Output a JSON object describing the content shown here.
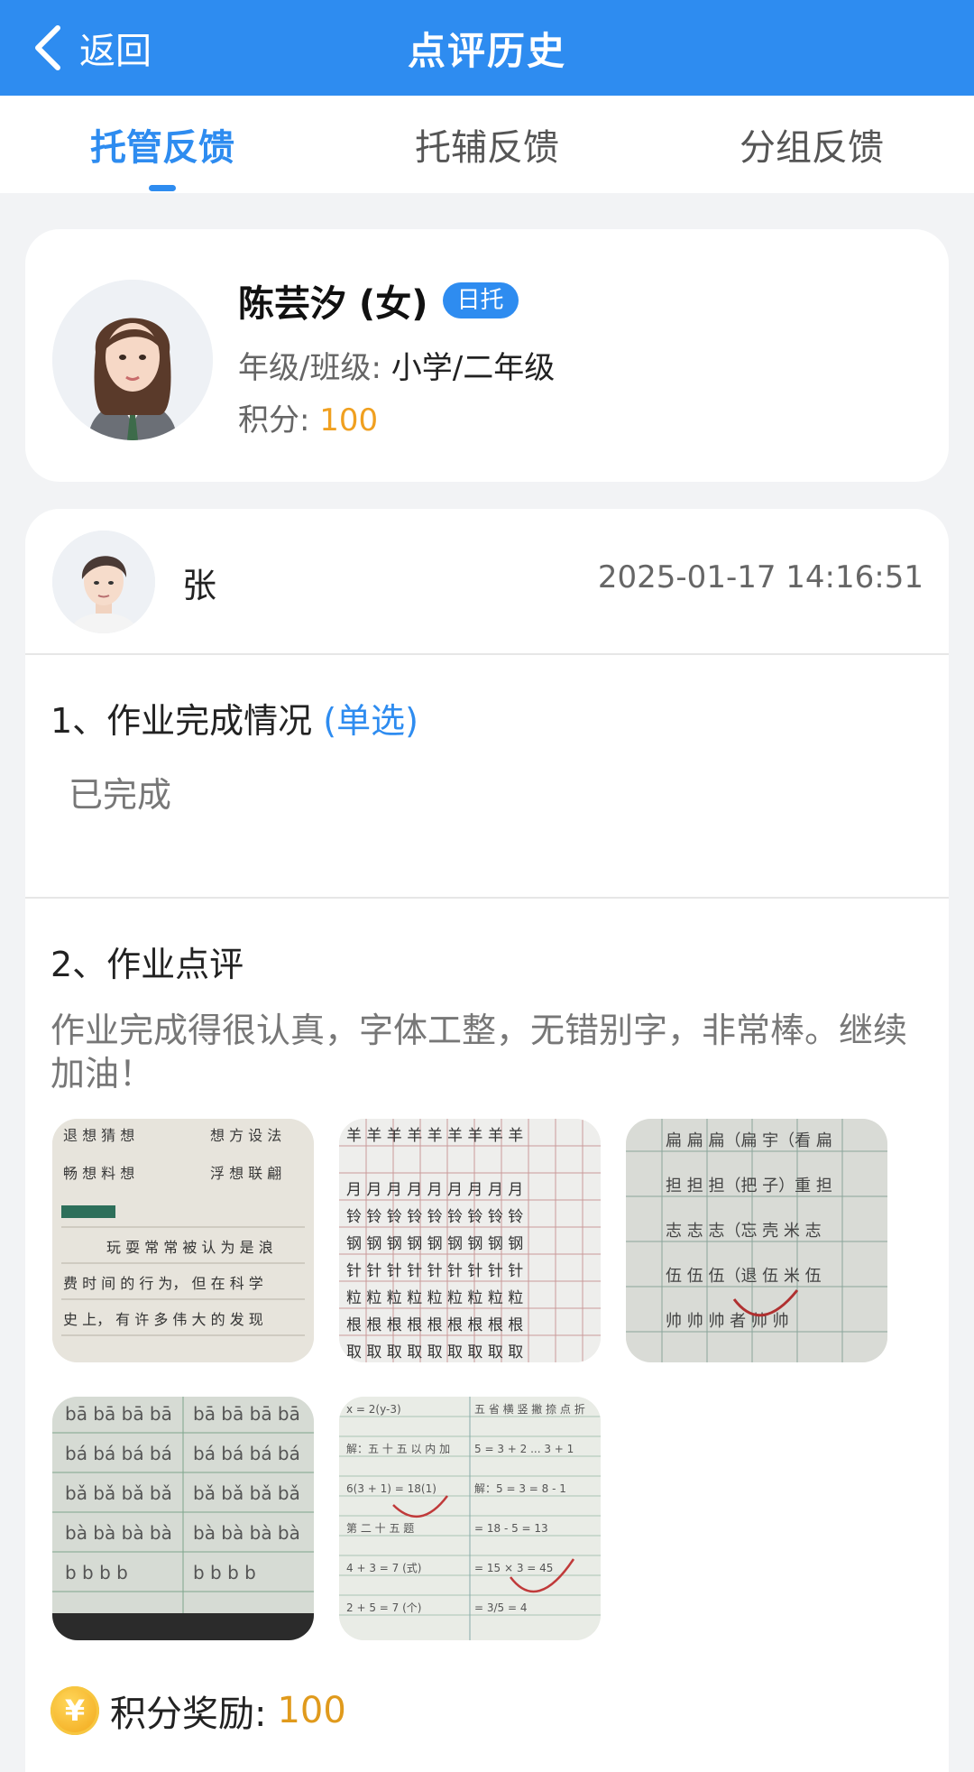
{
  "header": {
    "back_label": "返回",
    "title": "点评历史"
  },
  "tabs": [
    {
      "label": "托管反馈",
      "active": true
    },
    {
      "label": "托辅反馈",
      "active": false
    },
    {
      "label": "分组反馈",
      "active": false
    }
  ],
  "student": {
    "name": "陈芸汐 (女)",
    "badge": "日托",
    "grade_label": "年级/班级:",
    "grade_value": "小学/二年级",
    "points_label": "积分:",
    "points_value": "100"
  },
  "review": {
    "teacher_name": "张",
    "timestamp": "2025-01-17 14:16:51",
    "questions": [
      {
        "title": "1、作业完成情况",
        "tag": "(单选)",
        "answer": "已完成"
      },
      {
        "title": "2、作业点评",
        "comment": "作业完成得很认真，字体工整，无错别字，非常棒。继续加油！"
      }
    ],
    "photos": [
      {
        "label": "homework-photo-1"
      },
      {
        "label": "homework-photo-2"
      },
      {
        "label": "homework-photo-3"
      },
      {
        "label": "homework-photo-4"
      },
      {
        "label": "homework-photo-5"
      }
    ],
    "reward_label": "积分奖励:",
    "reward_value": "100"
  },
  "icons": {
    "back": "chevron-left-icon",
    "coin": "coin-icon",
    "coin_glyph": "¥"
  },
  "colors": {
    "primary": "#2e8cf0",
    "points": "#f0a020",
    "background": "#f2f3f5"
  }
}
